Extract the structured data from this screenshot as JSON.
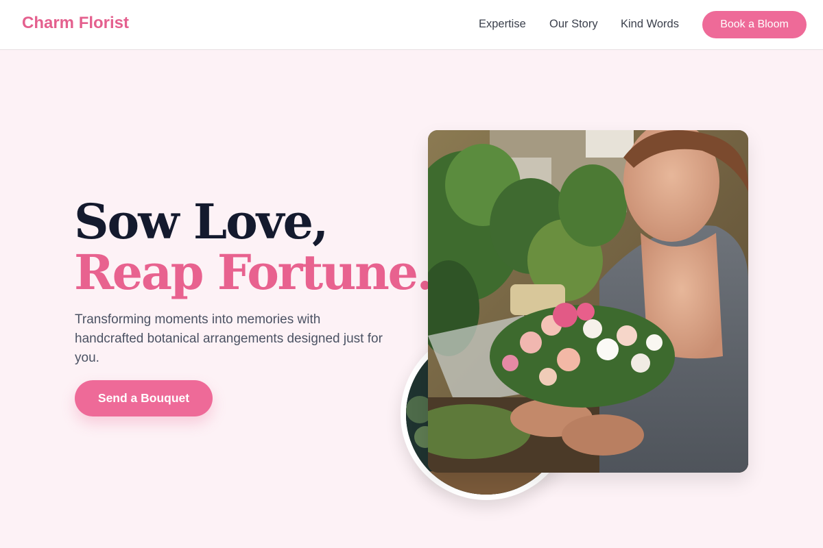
{
  "nav": {
    "brand": "Charm Florist",
    "links": [
      "Expertise",
      "Our Story",
      "Kind Words"
    ],
    "cta_label": "Book a Bloom"
  },
  "hero": {
    "headline_line1": "Sow Love,",
    "headline_line2": "Reap Fortune.",
    "subtitle": "Transforming moments into memories with handcrafted botanical arrangements designed just for you.",
    "cta_label": "Send a Bouquet"
  },
  "colors": {
    "accent": "#ee6a98",
    "brand_text": "#e4608e",
    "headline_dark": "#141a2e",
    "page_bg": "#fdf2f6"
  }
}
